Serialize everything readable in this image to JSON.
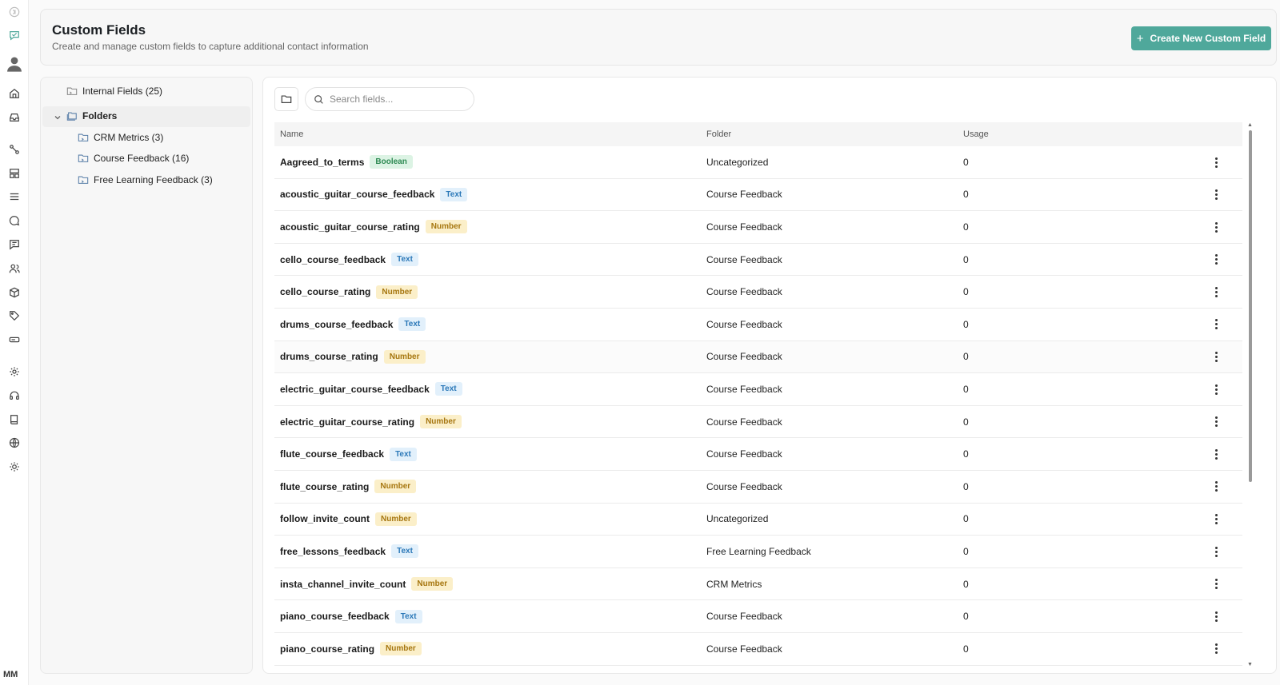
{
  "header": {
    "title": "Custom Fields",
    "subtitle": "Create and manage custom fields to capture additional contact information",
    "create_label": "Create New Custom Field"
  },
  "user": {
    "initials": "MM"
  },
  "folders": {
    "internal_label": "Internal Fields (25)",
    "group_label": "Folders",
    "items": [
      {
        "label": "CRM Metrics (3)"
      },
      {
        "label": "Course Feedback (16)"
      },
      {
        "label": "Free Learning Feedback (3)"
      }
    ]
  },
  "search": {
    "placeholder": "Search fields..."
  },
  "table": {
    "columns": {
      "name": "Name",
      "folder": "Folder",
      "usage": "Usage"
    },
    "rows": [
      {
        "name": "Aagreed_to_terms",
        "type": "Boolean",
        "folder": "Uncategorized",
        "usage": "0"
      },
      {
        "name": "acoustic_guitar_course_feedback",
        "type": "Text",
        "folder": "Course Feedback",
        "usage": "0"
      },
      {
        "name": "acoustic_guitar_course_rating",
        "type": "Number",
        "folder": "Course Feedback",
        "usage": "0"
      },
      {
        "name": "cello_course_feedback",
        "type": "Text",
        "folder": "Course Feedback",
        "usage": "0"
      },
      {
        "name": "cello_course_rating",
        "type": "Number",
        "folder": "Course Feedback",
        "usage": "0"
      },
      {
        "name": "drums_course_feedback",
        "type": "Text",
        "folder": "Course Feedback",
        "usage": "0"
      },
      {
        "name": "drums_course_rating",
        "type": "Number",
        "folder": "Course Feedback",
        "usage": "0"
      },
      {
        "name": "electric_guitar_course_feedback",
        "type": "Text",
        "folder": "Course Feedback",
        "usage": "0"
      },
      {
        "name": "electric_guitar_course_rating",
        "type": "Number",
        "folder": "Course Feedback",
        "usage": "0"
      },
      {
        "name": "flute_course_feedback",
        "type": "Text",
        "folder": "Course Feedback",
        "usage": "0"
      },
      {
        "name": "flute_course_rating",
        "type": "Number",
        "folder": "Course Feedback",
        "usage": "0"
      },
      {
        "name": "follow_invite_count",
        "type": "Number",
        "folder": "Uncategorized",
        "usage": "0"
      },
      {
        "name": "free_lessons_feedback",
        "type": "Text",
        "folder": "Free Learning Feedback",
        "usage": "0"
      },
      {
        "name": "insta_channel_invite_count",
        "type": "Number",
        "folder": "CRM Metrics",
        "usage": "0"
      },
      {
        "name": "piano_course_feedback",
        "type": "Text",
        "folder": "Course Feedback",
        "usage": "0"
      },
      {
        "name": "piano_course_rating",
        "type": "Number",
        "folder": "Course Feedback",
        "usage": "0"
      }
    ]
  },
  "colors": {
    "accent": "#4fa89b",
    "text_badge": "#2b78b8",
    "number_badge": "#a6760f",
    "boolean_badge": "#2d8a52"
  }
}
